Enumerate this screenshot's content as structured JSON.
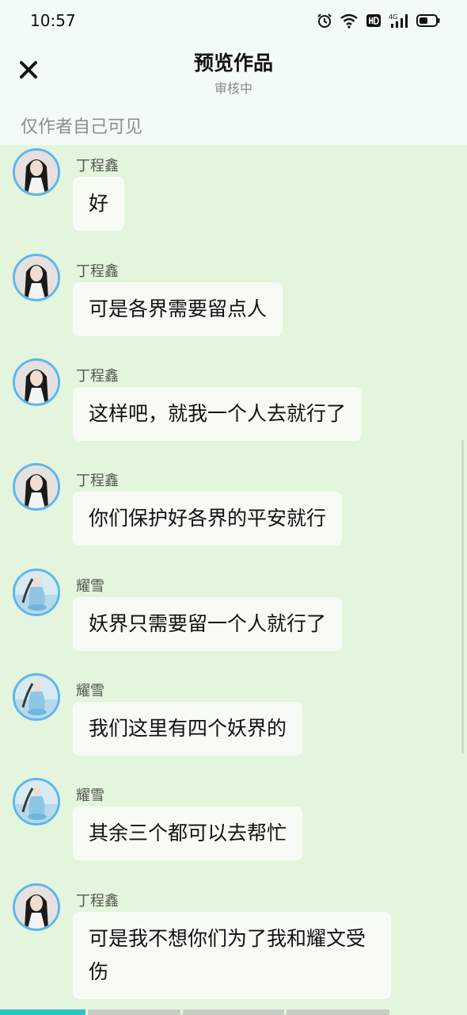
{
  "status_bar": {
    "time": "10:57",
    "battery_level": 0.55
  },
  "header": {
    "title": "预览作品",
    "subtitle": "审核中",
    "visibility_note": "仅作者自己可见"
  },
  "messages": [
    {
      "sender": "丁程鑫",
      "text": "好",
      "avatar": "ding-avatar"
    },
    {
      "sender": "丁程鑫",
      "text": "可是各界需要留点人",
      "avatar": "ding-avatar"
    },
    {
      "sender": "丁程鑫",
      "text": "这样吧，就我一个人去就行了",
      "avatar": "ding-avatar"
    },
    {
      "sender": "丁程鑫",
      "text": "你们保护好各界的平安就行",
      "avatar": "ding-avatar"
    },
    {
      "sender": "耀雪",
      "text": "妖界只需要留一个人就行了",
      "avatar": "yaoxue-avatar"
    },
    {
      "sender": "耀雪",
      "text": "我们这里有四个妖界的",
      "avatar": "yaoxue-avatar"
    },
    {
      "sender": "耀雪",
      "text": "其余三个都可以去帮忙",
      "avatar": "yaoxue-avatar"
    },
    {
      "sender": "丁程鑫",
      "text": "可是我不想你们为了我和耀文受伤",
      "avatar": "ding-avatar"
    }
  ],
  "colors": {
    "background": "#e3f5dc",
    "header_bg": "#f2fcf4",
    "bubble": "#f6fcf3",
    "avatar_ring": "#5db6ef",
    "progress_active": "#2fc3c9"
  }
}
